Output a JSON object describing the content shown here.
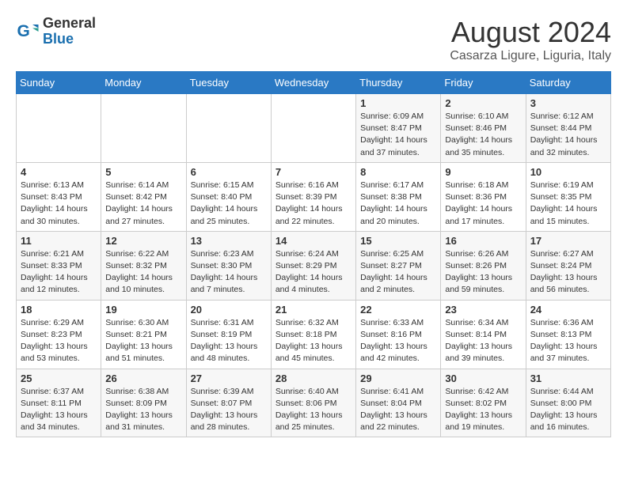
{
  "logo": {
    "line1": "General",
    "line2": "Blue"
  },
  "title": "August 2024",
  "subtitle": "Casarza Ligure, Liguria, Italy",
  "weekdays": [
    "Sunday",
    "Monday",
    "Tuesday",
    "Wednesday",
    "Thursday",
    "Friday",
    "Saturday"
  ],
  "weeks": [
    [
      {
        "day": "",
        "info": ""
      },
      {
        "day": "",
        "info": ""
      },
      {
        "day": "",
        "info": ""
      },
      {
        "day": "",
        "info": ""
      },
      {
        "day": "1",
        "info": "Sunrise: 6:09 AM\nSunset: 8:47 PM\nDaylight: 14 hours and 37 minutes."
      },
      {
        "day": "2",
        "info": "Sunrise: 6:10 AM\nSunset: 8:46 PM\nDaylight: 14 hours and 35 minutes."
      },
      {
        "day": "3",
        "info": "Sunrise: 6:12 AM\nSunset: 8:44 PM\nDaylight: 14 hours and 32 minutes."
      }
    ],
    [
      {
        "day": "4",
        "info": "Sunrise: 6:13 AM\nSunset: 8:43 PM\nDaylight: 14 hours and 30 minutes."
      },
      {
        "day": "5",
        "info": "Sunrise: 6:14 AM\nSunset: 8:42 PM\nDaylight: 14 hours and 27 minutes."
      },
      {
        "day": "6",
        "info": "Sunrise: 6:15 AM\nSunset: 8:40 PM\nDaylight: 14 hours and 25 minutes."
      },
      {
        "day": "7",
        "info": "Sunrise: 6:16 AM\nSunset: 8:39 PM\nDaylight: 14 hours and 22 minutes."
      },
      {
        "day": "8",
        "info": "Sunrise: 6:17 AM\nSunset: 8:38 PM\nDaylight: 14 hours and 20 minutes."
      },
      {
        "day": "9",
        "info": "Sunrise: 6:18 AM\nSunset: 8:36 PM\nDaylight: 14 hours and 17 minutes."
      },
      {
        "day": "10",
        "info": "Sunrise: 6:19 AM\nSunset: 8:35 PM\nDaylight: 14 hours and 15 minutes."
      }
    ],
    [
      {
        "day": "11",
        "info": "Sunrise: 6:21 AM\nSunset: 8:33 PM\nDaylight: 14 hours and 12 minutes."
      },
      {
        "day": "12",
        "info": "Sunrise: 6:22 AM\nSunset: 8:32 PM\nDaylight: 14 hours and 10 minutes."
      },
      {
        "day": "13",
        "info": "Sunrise: 6:23 AM\nSunset: 8:30 PM\nDaylight: 14 hours and 7 minutes."
      },
      {
        "day": "14",
        "info": "Sunrise: 6:24 AM\nSunset: 8:29 PM\nDaylight: 14 hours and 4 minutes."
      },
      {
        "day": "15",
        "info": "Sunrise: 6:25 AM\nSunset: 8:27 PM\nDaylight: 14 hours and 2 minutes."
      },
      {
        "day": "16",
        "info": "Sunrise: 6:26 AM\nSunset: 8:26 PM\nDaylight: 13 hours and 59 minutes."
      },
      {
        "day": "17",
        "info": "Sunrise: 6:27 AM\nSunset: 8:24 PM\nDaylight: 13 hours and 56 minutes."
      }
    ],
    [
      {
        "day": "18",
        "info": "Sunrise: 6:29 AM\nSunset: 8:23 PM\nDaylight: 13 hours and 53 minutes."
      },
      {
        "day": "19",
        "info": "Sunrise: 6:30 AM\nSunset: 8:21 PM\nDaylight: 13 hours and 51 minutes."
      },
      {
        "day": "20",
        "info": "Sunrise: 6:31 AM\nSunset: 8:19 PM\nDaylight: 13 hours and 48 minutes."
      },
      {
        "day": "21",
        "info": "Sunrise: 6:32 AM\nSunset: 8:18 PM\nDaylight: 13 hours and 45 minutes."
      },
      {
        "day": "22",
        "info": "Sunrise: 6:33 AM\nSunset: 8:16 PM\nDaylight: 13 hours and 42 minutes."
      },
      {
        "day": "23",
        "info": "Sunrise: 6:34 AM\nSunset: 8:14 PM\nDaylight: 13 hours and 39 minutes."
      },
      {
        "day": "24",
        "info": "Sunrise: 6:36 AM\nSunset: 8:13 PM\nDaylight: 13 hours and 37 minutes."
      }
    ],
    [
      {
        "day": "25",
        "info": "Sunrise: 6:37 AM\nSunset: 8:11 PM\nDaylight: 13 hours and 34 minutes."
      },
      {
        "day": "26",
        "info": "Sunrise: 6:38 AM\nSunset: 8:09 PM\nDaylight: 13 hours and 31 minutes."
      },
      {
        "day": "27",
        "info": "Sunrise: 6:39 AM\nSunset: 8:07 PM\nDaylight: 13 hours and 28 minutes."
      },
      {
        "day": "28",
        "info": "Sunrise: 6:40 AM\nSunset: 8:06 PM\nDaylight: 13 hours and 25 minutes."
      },
      {
        "day": "29",
        "info": "Sunrise: 6:41 AM\nSunset: 8:04 PM\nDaylight: 13 hours and 22 minutes."
      },
      {
        "day": "30",
        "info": "Sunrise: 6:42 AM\nSunset: 8:02 PM\nDaylight: 13 hours and 19 minutes."
      },
      {
        "day": "31",
        "info": "Sunrise: 6:44 AM\nSunset: 8:00 PM\nDaylight: 13 hours and 16 minutes."
      }
    ]
  ]
}
